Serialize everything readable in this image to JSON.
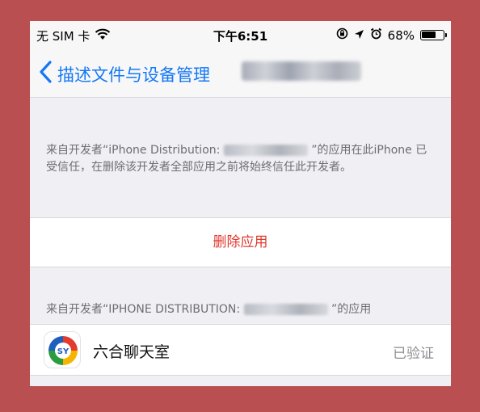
{
  "status_bar": {
    "carrier": "无 SIM 卡",
    "time": "下午6:51",
    "battery_percent": "68%",
    "battery_level": 0.68,
    "icons": [
      "wifi-icon",
      "lock-rotation-icon",
      "location-arrow-icon",
      "alarm-icon",
      "battery-icon"
    ]
  },
  "nav": {
    "back_icon": "chevron-left-icon",
    "title": "描述文件与设备管理",
    "title_color": "#1478f6"
  },
  "trust_section": {
    "text_prefix": "来自开发者“iPhone Distribution:",
    "text_suffix_line1": "”的应用在此",
    "text_body": "iPhone 已受信任，在删除该开发者全部应用之前将始终信任此开发者。"
  },
  "delete_button": {
    "label": "删除应用",
    "color": "#e0382f"
  },
  "apps_section": {
    "header_prefix": "来自开发者“IPHONE DISTRIBUTION:",
    "header_suffix": "”的应用",
    "apps": [
      {
        "name": "六合聊天室",
        "status": "已验证",
        "icon": "app-logo-icon"
      }
    ]
  }
}
